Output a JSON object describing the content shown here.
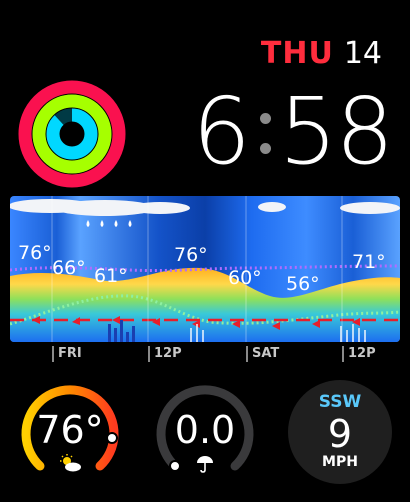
{
  "date": {
    "weekday": "THU",
    "day": "14"
  },
  "time": {
    "hours": "6",
    "minutes": "58"
  },
  "activity": {
    "move_color": "#fa114f",
    "exercise_color": "#a6ff00",
    "stand_color": "#00d8ff"
  },
  "forecast": {
    "temps": [
      "76°",
      "66°",
      "61°",
      "76°",
      "60°",
      "56°",
      "71°"
    ],
    "timeline": [
      "FRI",
      "12P",
      "SAT",
      "12P"
    ]
  },
  "complications": {
    "temperature": {
      "value": "76°",
      "icon": "partly-sunny-icon"
    },
    "precipitation": {
      "value": "0.0",
      "icon": "umbrella-icon"
    },
    "wind": {
      "direction": "SSW",
      "speed": "9",
      "unit": "MPH"
    }
  }
}
